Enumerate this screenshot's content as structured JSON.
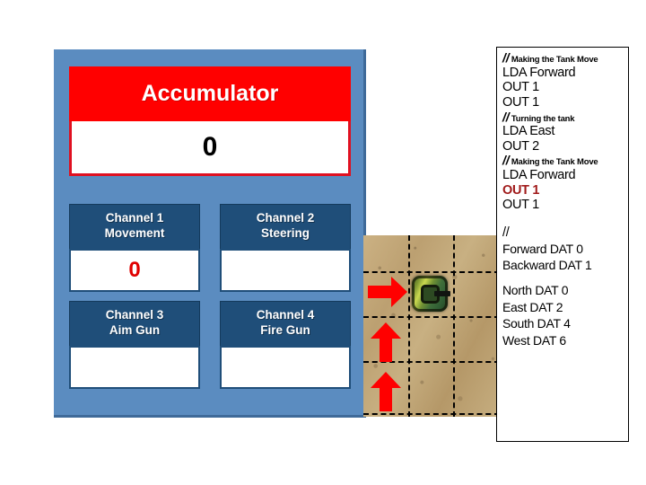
{
  "simulator": {
    "accumulator": {
      "title": "Accumulator",
      "value": "0",
      "header_color": "#FF0000",
      "value_color": "#000000"
    },
    "channels": [
      {
        "name": "Channel 1",
        "role": "Movement",
        "value": "0",
        "value_color": "#E00000"
      },
      {
        "name": "Channel 2",
        "role": "Steering",
        "value": "",
        "value_color": "#E00000"
      },
      {
        "name": "Channel 3",
        "role": "Aim Gun",
        "value": "",
        "value_color": "#E00000"
      },
      {
        "name": "Channel 4",
        "role": "Fire Gun",
        "value": "",
        "value_color": "#E00000"
      }
    ],
    "panel_color": "#5B8CC0",
    "channel_header_color": "#1F4E79"
  },
  "map": {
    "tank": {
      "icon": "tank-icon",
      "facing": "east"
    },
    "arrows": [
      {
        "icon": "arrow-right-icon",
        "direction": "right",
        "color": "#FF0000"
      },
      {
        "icon": "arrow-up-icon",
        "direction": "up",
        "color": "#FF0000"
      },
      {
        "icon": "arrow-up-icon",
        "direction": "up",
        "color": "#FF0000"
      }
    ],
    "grid_cols": 3,
    "grid_rows": 4
  },
  "code": {
    "lines": [
      {
        "type": "comment",
        "slashes": "//",
        "text": "Making the Tank Move"
      },
      {
        "type": "instruction",
        "text": "LDA Forward",
        "highlight": false
      },
      {
        "type": "instruction",
        "text": "OUT 1",
        "highlight": false
      },
      {
        "type": "instruction",
        "text": "OUT 1",
        "highlight": false
      },
      {
        "type": "comment",
        "slashes": "//",
        "text": "Turning the tank"
      },
      {
        "type": "instruction",
        "text": "LDA East",
        "highlight": false
      },
      {
        "type": "instruction",
        "text": "OUT 2",
        "highlight": false
      },
      {
        "type": "comment",
        "slashes": "//",
        "text": "Making the Tank Move"
      },
      {
        "type": "instruction",
        "text": "LDA Forward",
        "highlight": false
      },
      {
        "type": "instruction",
        "text": "OUT 1",
        "highlight": true
      },
      {
        "type": "instruction",
        "text": "OUT 1",
        "highlight": false
      }
    ],
    "legend_marker": "//",
    "legend_group_a": [
      "Forward DAT 0",
      "Backward DAT 1"
    ],
    "legend_group_b": [
      "North DAT 0",
      "East DAT 2",
      "South DAT 4",
      "West DAT 6"
    ],
    "highlight_color": "#A01A1A"
  }
}
